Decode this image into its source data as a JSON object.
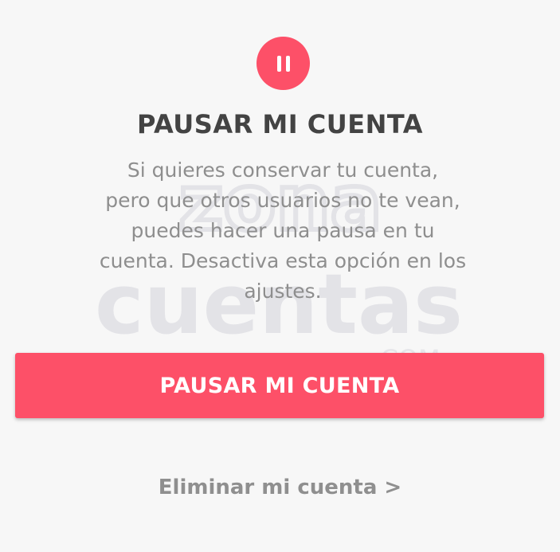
{
  "dialog": {
    "icon": "pause-icon",
    "title": "PAUSAR MI CUENTA",
    "description_lines": [
      "Si quieres conservar tu cuenta,",
      "pero que otros usuarios no te vean,",
      "puedes hacer una pausa en tu",
      "cuenta. Desactiva esta opción en los",
      "ajustes."
    ],
    "pause_button_label": "PAUSAR MI CUENTA",
    "delete_link_label": "Eliminar mi cuenta >"
  },
  "watermark": {
    "line1": "zona",
    "line2": "cuentas",
    "line3": ".COM"
  },
  "colors": {
    "accent": "#fd5068",
    "background": "#f7f7f7",
    "title": "#434343",
    "description": "#8e8e8e",
    "link": "#8f8f8f"
  }
}
